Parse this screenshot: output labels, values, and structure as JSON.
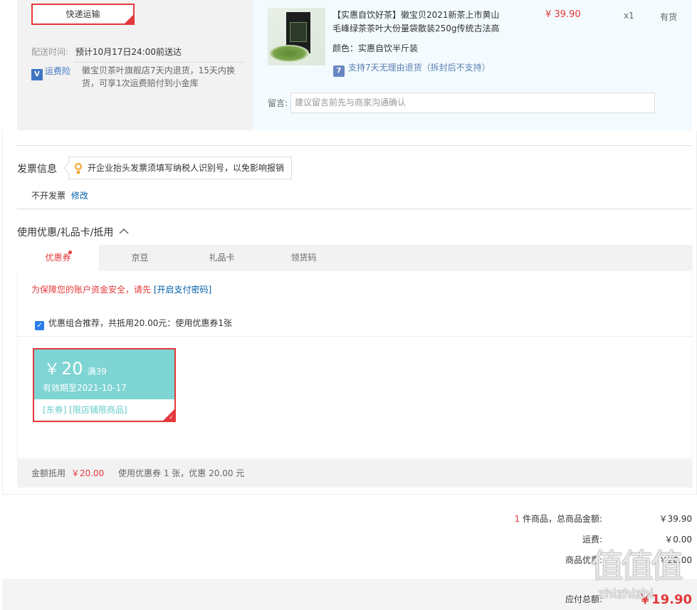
{
  "shipping": {
    "method_label": "快递运输",
    "delivery_time_label": "配送时间:",
    "delivery_time_value": "预计10月17日24:00前送达",
    "insurance_icon_text": "V",
    "insurance_label": "运费险",
    "insurance_desc_line1": "徽宝贝茶叶旗舰店7天内退货，15天内换",
    "insurance_desc_line2": "货，可享1次运费赔付到小金库"
  },
  "product": {
    "title_line1": "【实惠自饮好茶】徽宝贝2021新茶上市黄山",
    "title_line2": "毛峰绿茶茶叶大份量袋散装250g传统古法高",
    "price": "¥ 39.90",
    "qty": "x1",
    "stock": "有货",
    "color": "颜色：实惠自饮半斤装",
    "return_icon_text": "7",
    "return_policy": "支持7天无理由退货（拆封后不支持）",
    "message_label": "留言:",
    "message_placeholder": "建议留言前先与商家沟通确认"
  },
  "invoice": {
    "title": "发票信息",
    "tip": "开企业抬头发票须填写纳税人识别号，以免影响报销",
    "status": "不开发票",
    "modify": "修改"
  },
  "discount": {
    "title": "使用优惠/礼品卡/抵用",
    "toggle_icon": "chevron-up-icon",
    "tabs": [
      "优惠券",
      "京豆",
      "礼品卡",
      "领货码"
    ],
    "warning_text": "为保障您的账户资金安全，请先",
    "warning_link": "[开启支付密码]",
    "combo_text": "优惠组合推荐，共抵用20.00元：使用优惠券1张",
    "coupon": {
      "currency": "￥",
      "amount": "20",
      "condition": "满39",
      "validity": "有效期至2021-10-17",
      "tags": "[东券]  [限店铺限商品]"
    },
    "summary_label": "金额抵用",
    "summary_amount": "￥20.00",
    "summary_desc": "使用优惠券 1 张，优惠 20.00 元"
  },
  "totals": {
    "count": "1",
    "items_label": " 件商品，总商品金额:",
    "items_value": "￥39.90",
    "freight_label": "运费:",
    "freight_value": "￥0.00",
    "discount_label": "商品优惠:",
    "discount_value": "-￥20.00",
    "payable_label": "应付总额:",
    "payable_value": "￥19.90"
  },
  "watermark": {
    "logo": "值",
    "site": "zhizhizhi"
  },
  "colors": {
    "accent_red": "#e4393c",
    "coupon_teal": "#7fd4d4",
    "link_blue": "#005ea7"
  }
}
